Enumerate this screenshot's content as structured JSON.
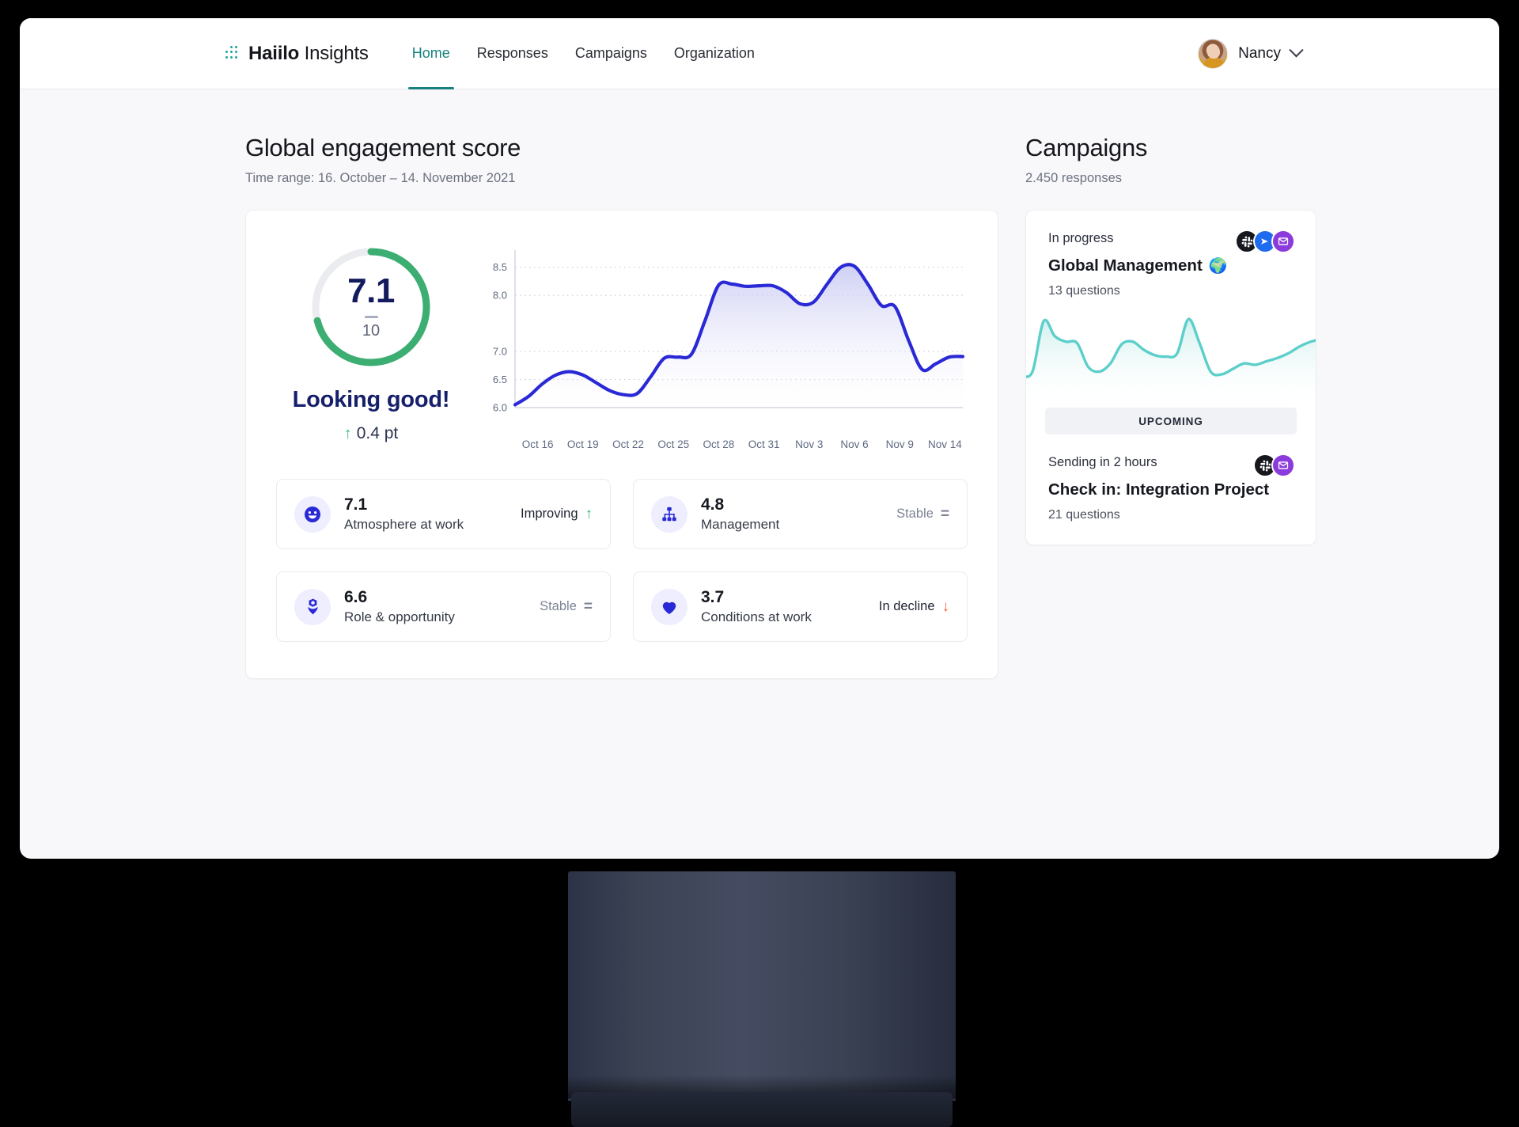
{
  "brand": {
    "name_bold": "Haiilo",
    "name_light": "Insights"
  },
  "nav": {
    "items": [
      {
        "label": "Home",
        "active": true
      },
      {
        "label": "Responses",
        "active": false
      },
      {
        "label": "Campaigns",
        "active": false
      },
      {
        "label": "Organization",
        "active": false
      }
    ]
  },
  "user": {
    "name": "Nancy",
    "chevron": "chevron-down-icon"
  },
  "engagement": {
    "title": "Global engagement score",
    "time_range": "Time range: 16. October  –  14. November 2021",
    "gauge": {
      "value": "7.1",
      "max": "10",
      "percent": 71,
      "track_color": "#ebecf0",
      "progress_color": "#3cae72"
    },
    "caption": "Looking good!",
    "delta": "0.4 pt",
    "delta_direction": "up",
    "delta_arrow": "↑"
  },
  "metrics": [
    {
      "value": "7.1",
      "label": "Atmosphere at work",
      "trend": "Improving",
      "trend_type": "improving",
      "trend_arrow": "↑",
      "icon": "smiley-face-icon"
    },
    {
      "value": "4.8",
      "label": "Management",
      "trend": "Stable",
      "trend_type": "stable",
      "trend_arrow": "=",
      "icon": "org-chart-icon"
    },
    {
      "value": "6.6",
      "label": "Role & opportunity",
      "trend": "Stable",
      "trend_type": "stable",
      "trend_arrow": "=",
      "icon": "flower-badge-icon"
    },
    {
      "value": "3.7",
      "label": "Conditions at work",
      "trend": "In decline",
      "trend_type": "decline",
      "trend_arrow": "↓",
      "icon": "heart-icon"
    }
  ],
  "campaigns": {
    "title": "Campaigns",
    "responses": "2.450 responses",
    "in_progress": {
      "status": "In progress",
      "name": "Global Management",
      "emoji": "🌍",
      "questions": "13 questions",
      "channels": [
        "slack-icon",
        "send-icon",
        "mail-icon"
      ]
    },
    "upcoming_label": "UPCOMING",
    "upcoming": {
      "status": "Sending in 2 hours",
      "name": "Check in: Integration Project",
      "questions": "21 questions",
      "channels": [
        "slack-icon",
        "mail-icon"
      ]
    }
  },
  "chart_data": {
    "type": "area",
    "title": "Global engagement score over time",
    "xlabel": "",
    "ylabel": "",
    "ylim": [
      6.0,
      8.75
    ],
    "yticks": [
      "6.0",
      "6.5",
      "7.0",
      "7.5",
      "8.0",
      "8.5"
    ],
    "ytick_labels_shown": [
      "6.0",
      "6.5",
      "7.0",
      "8.0",
      "8.5"
    ],
    "grid": true,
    "line_color": "#2a29d6",
    "fill_gradient": [
      "#c9caf5",
      "#ffffff"
    ],
    "categories": [
      "Oct 16",
      "Oct 19",
      "Oct 22",
      "Oct 25",
      "Oct 28",
      "Oct 31",
      "Nov 3",
      "Nov 6",
      "Nov 9",
      "Nov 14"
    ],
    "x": [
      "Oct 15",
      "Oct 16",
      "Oct 17",
      "Oct 18",
      "Oct 19",
      "Oct 20",
      "Oct 21",
      "Oct 22",
      "Oct 23",
      "Oct 24",
      "Oct 25",
      "Oct 26",
      "Oct 27",
      "Oct 28",
      "Oct 29",
      "Oct 30",
      "Oct 31",
      "Nov 1",
      "Nov 2",
      "Nov 3",
      "Nov 4",
      "Nov 5",
      "Nov 6",
      "Nov 7",
      "Nov 8",
      "Nov 9",
      "Nov 10",
      "Nov 11",
      "Nov 12",
      "Nov 13",
      "Nov 14"
    ],
    "values": [
      6.05,
      6.2,
      6.42,
      6.58,
      6.64,
      6.58,
      6.44,
      6.3,
      6.23,
      6.25,
      6.55,
      6.88,
      6.9,
      6.95,
      7.55,
      8.18,
      8.2,
      8.16,
      8.17,
      8.17,
      8.05,
      7.85,
      7.88,
      8.2,
      8.5,
      8.52,
      8.2,
      7.82,
      7.8,
      7.2,
      6.68,
      6.78,
      6.9,
      6.91
    ],
    "series": [
      {
        "name": "Engagement score",
        "values": [
          6.05,
          6.2,
          6.42,
          6.58,
          6.64,
          6.58,
          6.44,
          6.3,
          6.23,
          6.25,
          6.55,
          6.88,
          6.9,
          6.95,
          7.55,
          8.18,
          8.2,
          8.16,
          8.17,
          8.17,
          8.05,
          7.85,
          7.88,
          8.2,
          8.5,
          8.52,
          8.2,
          7.82,
          7.8,
          7.2,
          6.68,
          6.78,
          6.9,
          6.91
        ]
      }
    ]
  },
  "sparkline": {
    "type": "area",
    "line_color": "#5ccfcb",
    "fill_gradient": [
      "#d3f2f0",
      "#ffffff"
    ],
    "values": [
      0.12,
      0.18,
      0.92,
      0.7,
      0.62,
      0.6,
      0.25,
      0.18,
      0.3,
      0.58,
      0.62,
      0.5,
      0.42,
      0.4,
      0.45,
      0.95,
      0.6,
      0.18,
      0.14,
      0.22,
      0.3,
      0.28,
      0.33,
      0.38,
      0.45,
      0.55,
      0.62,
      0.66
    ]
  }
}
